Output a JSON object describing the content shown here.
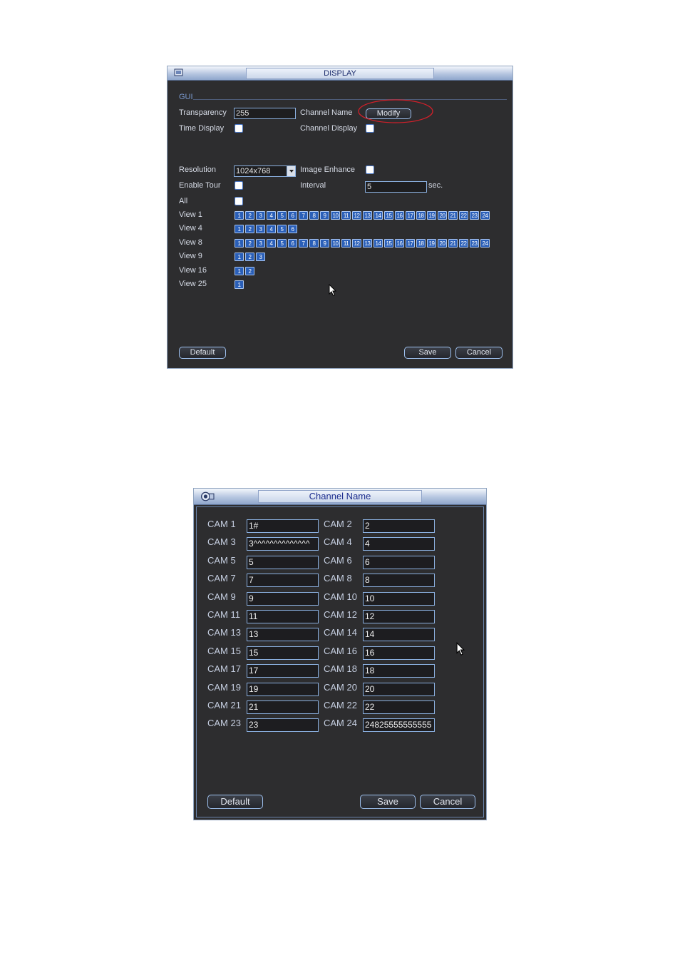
{
  "display_window": {
    "title": "DISPLAY",
    "section_label": "GUI",
    "transparency": {
      "label": "Transparency",
      "value": "255"
    },
    "channel_name": {
      "label": "Channel Name",
      "button": "Modify"
    },
    "time_display": {
      "label": "Time Display"
    },
    "channel_display": {
      "label": "Channel Display"
    },
    "resolution": {
      "label": "Resolution",
      "value": "1024x768"
    },
    "image_enhance": {
      "label": "Image Enhance"
    },
    "enable_tour": {
      "label": "Enable Tour"
    },
    "interval": {
      "label": "Interval",
      "value": "5",
      "unit": "sec."
    },
    "all": {
      "label": "All"
    },
    "views": [
      {
        "label": "View 1",
        "channels": [
          "1",
          "2",
          "3",
          "4",
          "5",
          "6",
          "7",
          "8",
          "9",
          "10",
          "11",
          "12",
          "13",
          "14",
          "15",
          "16",
          "17",
          "18",
          "19",
          "20",
          "21",
          "22",
          "23",
          "24"
        ]
      },
      {
        "label": "View 4",
        "channels": [
          "1",
          "2",
          "3",
          "4",
          "5",
          "6"
        ]
      },
      {
        "label": "View 8",
        "channels": [
          "1",
          "2",
          "3",
          "4",
          "5",
          "6",
          "7",
          "8",
          "9",
          "10",
          "11",
          "12",
          "13",
          "14",
          "15",
          "16",
          "17",
          "18",
          "19",
          "20",
          "21",
          "22",
          "23",
          "24"
        ]
      },
      {
        "label": "View 9",
        "channels": [
          "1",
          "2",
          "3"
        ]
      },
      {
        "label": "View 16",
        "channels": [
          "1",
          "2"
        ]
      },
      {
        "label": "View 25",
        "channels": [
          "1"
        ]
      }
    ],
    "buttons": {
      "default": "Default",
      "save": "Save",
      "cancel": "Cancel"
    }
  },
  "channel_window": {
    "title": "Channel Name",
    "cams": [
      {
        "label": "CAM 1",
        "value": "1#"
      },
      {
        "label": "CAM 2",
        "value": "2"
      },
      {
        "label": "CAM 3",
        "value": "3^^^^^^^^^^^^^^"
      },
      {
        "label": "CAM 4",
        "value": "4"
      },
      {
        "label": "CAM 5",
        "value": "5"
      },
      {
        "label": "CAM 6",
        "value": "6"
      },
      {
        "label": "CAM 7",
        "value": "7"
      },
      {
        "label": "CAM 8",
        "value": "8"
      },
      {
        "label": "CAM 9",
        "value": "9"
      },
      {
        "label": "CAM 10",
        "value": "10"
      },
      {
        "label": "CAM 11",
        "value": "11"
      },
      {
        "label": "CAM 12",
        "value": "12"
      },
      {
        "label": "CAM 13",
        "value": "13"
      },
      {
        "label": "CAM 14",
        "value": "14"
      },
      {
        "label": "CAM 15",
        "value": "15"
      },
      {
        "label": "CAM 16",
        "value": "16"
      },
      {
        "label": "CAM 17",
        "value": "17"
      },
      {
        "label": "CAM 18",
        "value": "18"
      },
      {
        "label": "CAM 19",
        "value": "19"
      },
      {
        "label": "CAM 20",
        "value": "20"
      },
      {
        "label": "CAM 21",
        "value": "21"
      },
      {
        "label": "CAM 22",
        "value": "22"
      },
      {
        "label": "CAM 23",
        "value": "23"
      },
      {
        "label": "CAM 24",
        "value": "24825555555555"
      }
    ],
    "buttons": {
      "default": "Default",
      "save": "Save",
      "cancel": "Cancel"
    }
  },
  "colors": {
    "highlight_ellipse": "#d0202a",
    "window_bg": "#2d2d2f",
    "accent": "#8bb0e0"
  }
}
